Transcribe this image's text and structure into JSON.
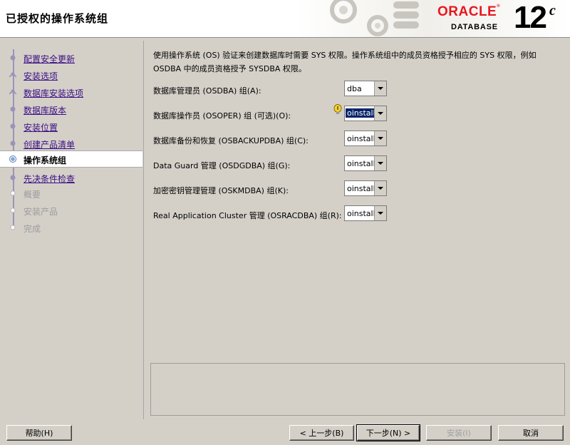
{
  "window": {
    "title": "已授权的操作系统组"
  },
  "branding": {
    "oracle": "ORACLE",
    "database": "DATABASE",
    "version": "12",
    "version_suffix": "c",
    "colors": {
      "oracle_red": "#e8171f"
    }
  },
  "nav": {
    "items": [
      {
        "label": "配置安全更新",
        "state": "done"
      },
      {
        "label": "安装选项",
        "state": "done"
      },
      {
        "label": "数据库安装选项",
        "state": "done"
      },
      {
        "label": "数据库版本",
        "state": "done"
      },
      {
        "label": "安装位置",
        "state": "done"
      },
      {
        "label": "创建产品清单",
        "state": "done"
      },
      {
        "label": "操作系统组",
        "state": "current"
      },
      {
        "label": "先决条件检查",
        "state": "next"
      },
      {
        "label": "概要",
        "state": "disabled"
      },
      {
        "label": "安装产品",
        "state": "disabled"
      },
      {
        "label": "完成",
        "state": "disabled"
      }
    ]
  },
  "content": {
    "description": "使用操作系统 (OS) 验证来创建数据库时需要 SYS 权限。操作系统组中的成员资格授予相应的 SYS 权限，例如 OSDBA 中的成员资格授予 SYSDBA 权限。",
    "rows": [
      {
        "label": "数据库管理员 (OSDBA) 组(A):",
        "value": "dba",
        "selected": false,
        "hint": false
      },
      {
        "label": "数据库操作员 (OSOPER) 组 (可选)(O):",
        "value": "oinstall",
        "selected": true,
        "hint": true
      },
      {
        "label": "数据库备份和恢复 (OSBACKUPDBA) 组(C):",
        "value": "oinstall",
        "selected": false,
        "hint": false
      },
      {
        "label": "Data Guard 管理 (OSDGDBA) 组(G):",
        "value": "oinstall",
        "selected": false,
        "hint": false
      },
      {
        "label": "加密密钥管理管理 (OSKMDBA) 组(K):",
        "value": "oinstall",
        "selected": false,
        "hint": false
      },
      {
        "label": "Real Application Cluster 管理 (OSRACDBA) 组(R):",
        "value": "oinstall",
        "selected": false,
        "hint": false
      }
    ]
  },
  "buttons": {
    "help": "帮助(H)",
    "back": "< 上一步(B)",
    "next": "下一步(N) >",
    "install": "安装(I)",
    "cancel": "取消"
  }
}
